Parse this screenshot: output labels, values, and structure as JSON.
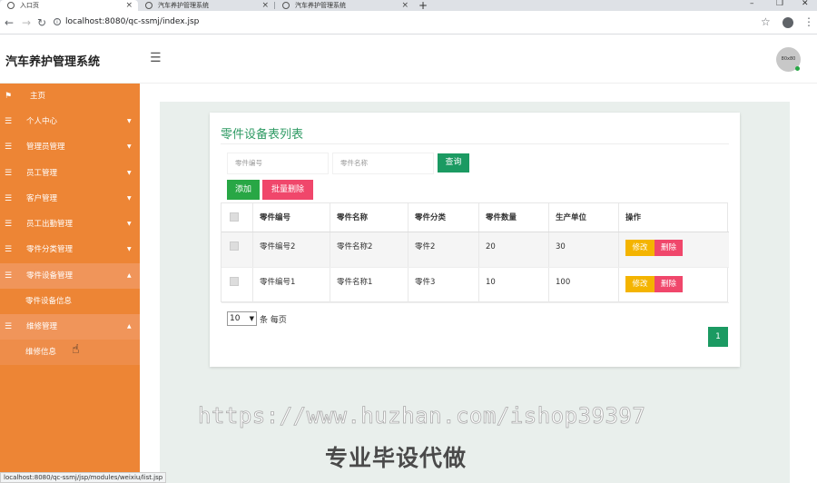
{
  "browser": {
    "tabs": [
      {
        "title": "入口页",
        "active": true
      },
      {
        "title": "汽车养护管理系统",
        "active": false
      },
      {
        "title": "汽车养护管理系统",
        "active": false
      }
    ],
    "url": "localhost:8080/qc-ssmj/index.jsp",
    "status_url": "localhost:8080/qc-ssmj/jsp/modules/weixiu/list.jsp"
  },
  "header": {
    "brand": "汽车养护管理系统",
    "avatar_text": "80x80"
  },
  "sidebar": {
    "items": [
      {
        "label": "主页",
        "icon": "flag-icon"
      },
      {
        "label": "个人中心",
        "icon": "list-icon"
      },
      {
        "label": "管理员管理",
        "icon": "list-icon"
      },
      {
        "label": "员工管理",
        "icon": "list-icon"
      },
      {
        "label": "客户管理",
        "icon": "list-icon"
      },
      {
        "label": "员工出勤管理",
        "icon": "list-icon"
      },
      {
        "label": "零件分类管理",
        "icon": "list-icon"
      },
      {
        "label": "零件设备管理",
        "icon": "list-icon",
        "open": true
      },
      {
        "label": "零件设备信息",
        "sub": true
      },
      {
        "label": "维修管理",
        "icon": "list-icon",
        "open": true
      },
      {
        "label": "维修信息",
        "sub": true
      }
    ]
  },
  "main": {
    "title": "零件设备表列表",
    "search": {
      "part_no_placeholder": "零件编号",
      "part_name_placeholder": "零件名称",
      "search_label": "查询"
    },
    "actions": {
      "add_label": "添加",
      "bulk_delete_label": "批量删除"
    },
    "table": {
      "headers": [
        "零件编号",
        "零件名称",
        "零件分类",
        "零件数量",
        "生产单位",
        "操作"
      ],
      "rows": [
        {
          "part_no": "零件编号2",
          "part_name": "零件名称2",
          "category": "零件2",
          "quantity": "20",
          "producer": "30"
        },
        {
          "part_no": "零件编号1",
          "part_name": "零件名称1",
          "category": "零件3",
          "quantity": "10",
          "producer": "100"
        }
      ],
      "edit_label": "修改",
      "delete_label": "删除"
    },
    "pagination": {
      "page_size": "10",
      "per_page_label": "条 每页",
      "current_page": "1"
    }
  },
  "watermark": {
    "url": "https://www.huzhan.com/ishop39397",
    "text": "专业毕设代做"
  },
  "colors": {
    "sidebar": "#ed8535",
    "primary": "#1b9a62",
    "danger": "#f0476b",
    "warning": "#f4b400",
    "success": "#28a745"
  }
}
